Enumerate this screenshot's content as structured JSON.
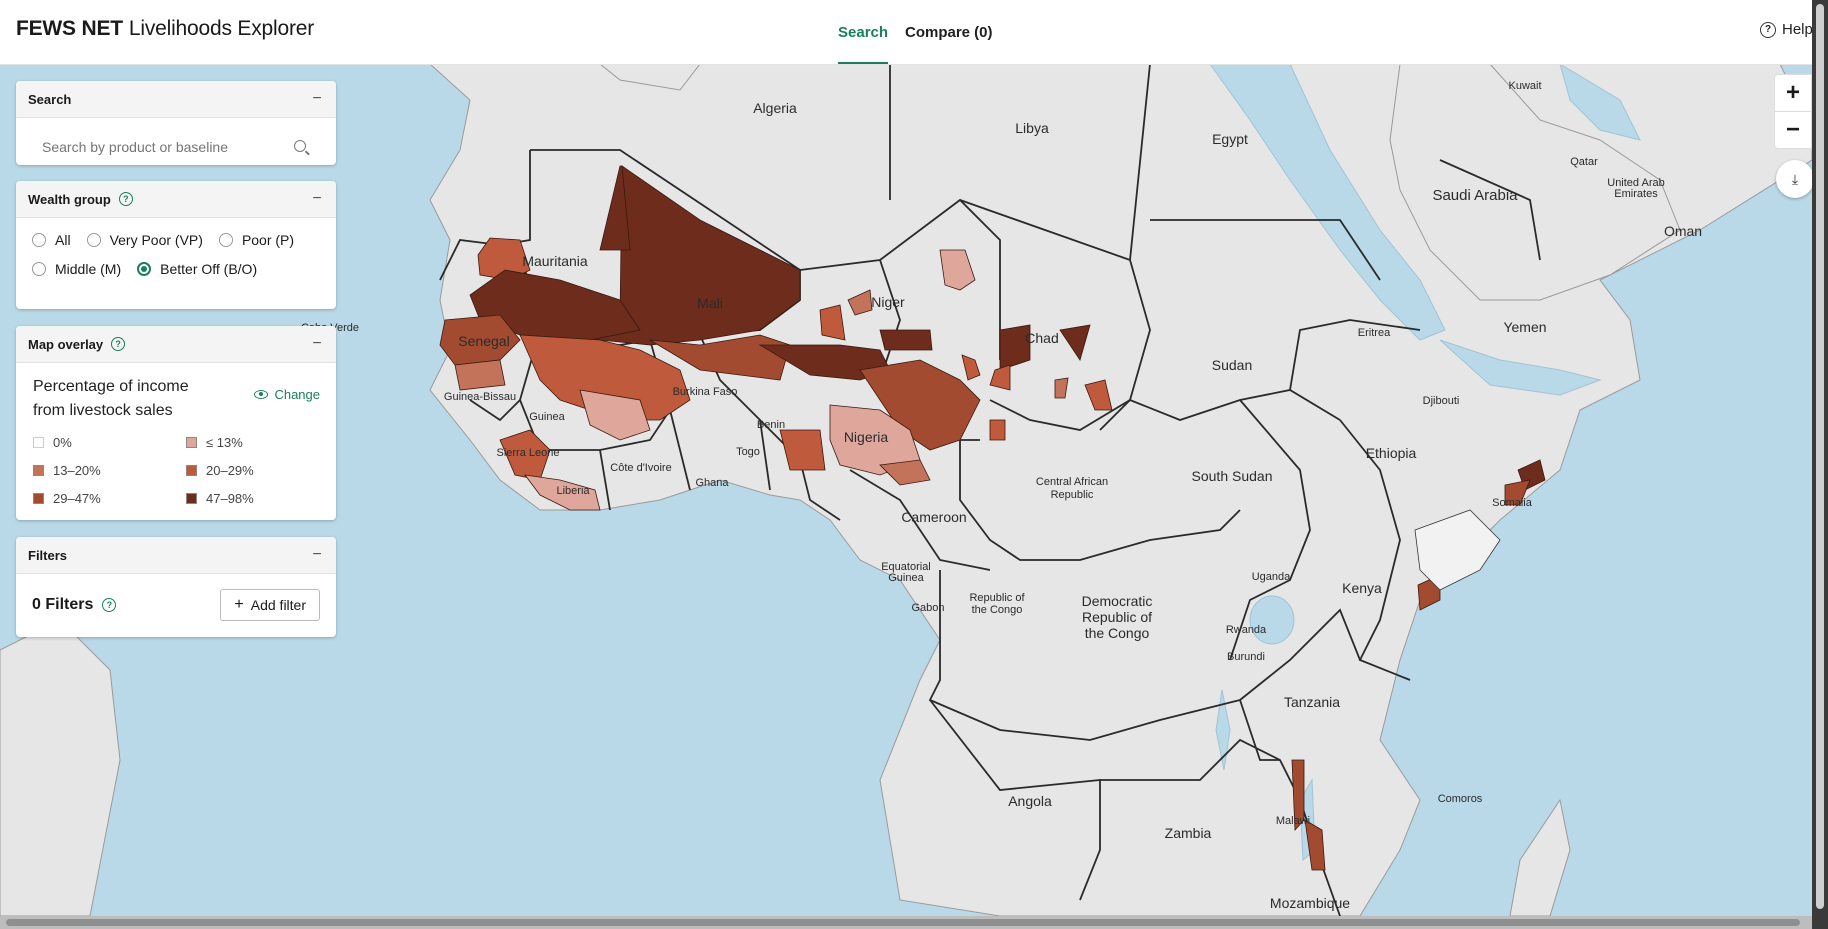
{
  "app": {
    "brand_bold": "FEWS NET",
    "brand_rest": "Livelihoods Explorer"
  },
  "nav": {
    "search": "Search",
    "compare": "Compare (0)",
    "help": "Help"
  },
  "search_panel": {
    "title": "Search",
    "placeholder": "Search by product or baseline"
  },
  "wealth_panel": {
    "title": "Wealth group",
    "options": [
      "All",
      "Very Poor (VP)",
      "Poor (P)",
      "Middle (M)",
      "Better Off (B/O)"
    ],
    "selected": "Better Off (B/O)"
  },
  "overlay_panel": {
    "title": "Map overlay",
    "metric": "Percentage of income from livestock sales",
    "change": "Change",
    "legend": [
      {
        "label": "0%",
        "color": "#ffffff"
      },
      {
        "label": "≤ 13%",
        "color": "#dfa79b"
      },
      {
        "label": "13–20%",
        "color": "#c2735a"
      },
      {
        "label": "20–29%",
        "color": "#bf5a3c"
      },
      {
        "label": "29–47%",
        "color": "#a34b30"
      },
      {
        "label": "47–98%",
        "color": "#6e2c1c"
      }
    ]
  },
  "filters_panel": {
    "title": "Filters",
    "count": "0 Filters",
    "add": "Add filter"
  },
  "map": {
    "zoom_in": "+",
    "zoom_out": "−",
    "labels": [
      "Algeria",
      "Libya",
      "Egypt",
      "Kuwait",
      "Qatar",
      "United Arab",
      "Emirates",
      "Saudi Arabia",
      "Oman",
      "Mauritania",
      "Mali",
      "Niger",
      "Chad",
      "Senegal",
      "Cabo Verde",
      "Guinea-Bissau",
      "Guinea",
      "Burkina Faso",
      "Benin",
      "Togo",
      "Nigeria",
      "Sierra Leone",
      "Liberia",
      "Côte d'Ivoire",
      "Ghana",
      "Cameroon",
      "Sudan",
      "Eritrea",
      "Yemen",
      "Djibouti",
      "Ethiopia",
      "Somalia",
      "South Sudan",
      "Central African",
      "Republic",
      "Equatorial",
      "Guinea",
      "Gabon",
      "Republic of",
      "the Congo",
      "Democratic",
      "Republic of",
      "the Congo",
      "Uganda",
      "Kenya",
      "Rwanda",
      "Burundi",
      "Tanzania",
      "Angola",
      "Zambia",
      "Malawi",
      "Comoros",
      "Mozambique"
    ]
  }
}
